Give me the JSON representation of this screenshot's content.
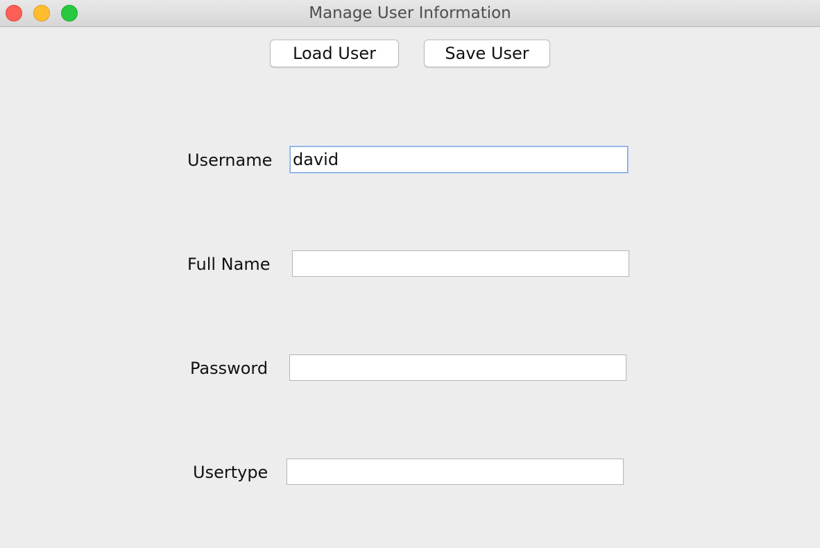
{
  "window": {
    "title": "Manage User Information"
  },
  "toolbar": {
    "load_label": "Load User",
    "save_label": "Save User"
  },
  "form": {
    "username": {
      "label": "Username",
      "value": "david"
    },
    "full_name": {
      "label": "Full Name",
      "value": ""
    },
    "password": {
      "label": "Password",
      "value": ""
    },
    "usertype": {
      "label": "Usertype",
      "value": ""
    }
  },
  "colors": {
    "window_background": "#ededed",
    "close": "#fe5f57",
    "minimize": "#febc2e",
    "zoom": "#28c840",
    "focus_ring": "#7aa7e0"
  }
}
